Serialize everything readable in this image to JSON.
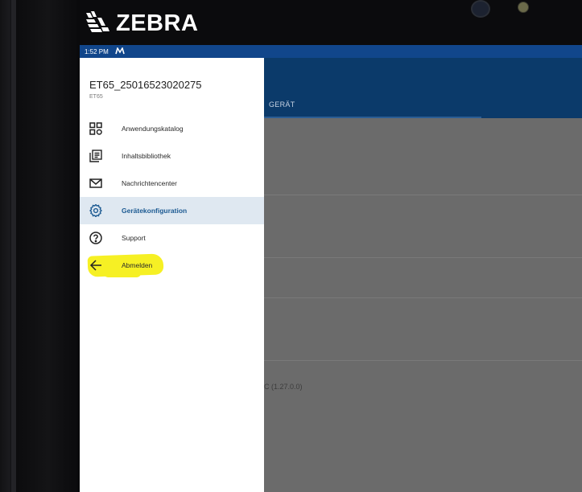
{
  "device": {
    "brand": "ZEBRA",
    "brand_icon": "zebra-head-logo"
  },
  "statusbar": {
    "time": "1:52 PM",
    "notification_icon": "m-app-icon"
  },
  "app": {
    "tab_label": "GERÄT",
    "version_text": "C (1.27.0.0)"
  },
  "drawer": {
    "device_name": "ET65_25016523020275",
    "device_model": "ET65",
    "items": [
      {
        "label": "Anwendungskatalog",
        "icon": "app-catalog-icon"
      },
      {
        "label": "Inhaltsbibliothek",
        "icon": "content-library-icon"
      },
      {
        "label": "Nachrichtencenter",
        "icon": "mail-icon"
      },
      {
        "label": "Gerätekonfiguration",
        "icon": "gear-icon",
        "active": true
      },
      {
        "label": "Support",
        "icon": "help-icon"
      },
      {
        "label": "Abmelden",
        "icon": "logout-icon",
        "highlighted": true
      }
    ]
  },
  "colors": {
    "statusbar": "#11468b",
    "header": "#0b3a6a",
    "active_item_bg": "#dfe8f1",
    "active_item_text": "#1c5a92",
    "highlight": "#f6f024"
  }
}
